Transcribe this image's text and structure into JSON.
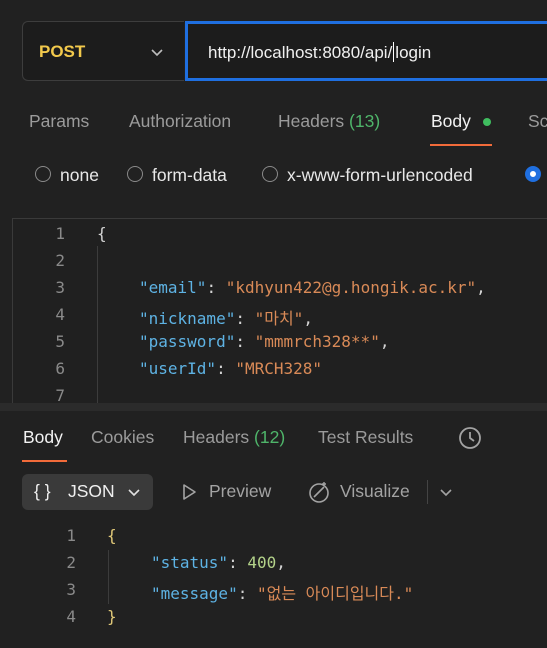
{
  "request": {
    "method": "POST",
    "url_before_caret": "http://localhost:8080/api/",
    "url_after_caret": "login"
  },
  "request_tabs": [
    {
      "label": "Params"
    },
    {
      "label": "Authorization"
    },
    {
      "label": "Headers",
      "count": "(13)"
    },
    {
      "label": "Body"
    },
    {
      "label": "Sc"
    }
  ],
  "body_types": [
    "none",
    "form-data",
    "x-www-form-urlencoded"
  ],
  "request_body": {
    "line_numbers": [
      "1",
      "2",
      "3",
      "4",
      "5",
      "6",
      "7"
    ],
    "open_brace": "{",
    "fields": [
      {
        "key": "\"email\"",
        "value": "\"kdhyun422@g.hongik.ac.kr\"",
        "trail": ","
      },
      {
        "key": "\"nickname\"",
        "value": "\"마치\"",
        "trail": ","
      },
      {
        "key": "\"password\"",
        "value": "\"mmmrch328**\"",
        "trail": ","
      },
      {
        "key": "\"userId\"",
        "value": "\"MRCH328\"",
        "trail": ""
      }
    ]
  },
  "response_tabs": [
    {
      "label": "Body"
    },
    {
      "label": "Cookies"
    },
    {
      "label": "Headers",
      "count": "(12)"
    },
    {
      "label": "Test Results"
    }
  ],
  "response_toolbar": {
    "format_icon": "{ }",
    "format_label": "JSON",
    "preview_label": "Preview",
    "visualize_label": "Visualize"
  },
  "response_body": {
    "line_numbers": [
      "1",
      "2",
      "3",
      "4"
    ],
    "open_brace": "{",
    "close_brace": "}",
    "status_key": "\"status\"",
    "status_value": "400",
    "message_key": "\"message\"",
    "message_value": "\"없는 아이디입니다.\""
  },
  "colors": {
    "accent_blue": "#1f6fe0",
    "method_yellow": "#f2c94c",
    "tab_underline": "#f26b3a",
    "count_green": "#4fb56a",
    "json_key": "#5eb3e4",
    "json_string": "#d98a57",
    "json_number": "#b4d38a"
  },
  "icons": [
    "chevron-down-icon",
    "history-icon",
    "play-icon",
    "visualize-icon"
  ]
}
